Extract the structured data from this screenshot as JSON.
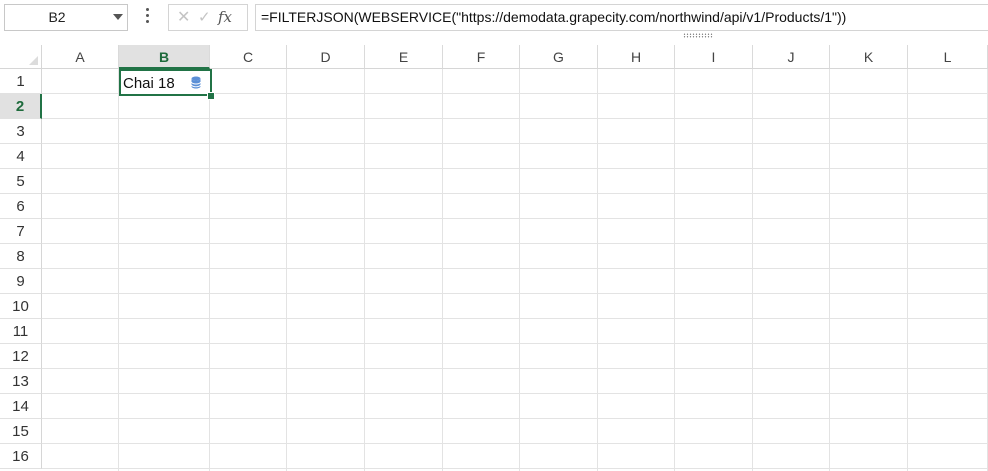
{
  "formula_bar": {
    "name_box": "B2",
    "cancel_icon": "close-icon",
    "enter_icon": "check-icon",
    "fx_label": "fx",
    "formula": "=FILTERJSON(WEBSERVICE(\"https://demodata.grapecity.com/northwind/api/v1/Products/1\"))"
  },
  "columns": [
    "A",
    "B",
    "C",
    "D",
    "E",
    "F",
    "G",
    "H",
    "I",
    "J",
    "K",
    "L"
  ],
  "rows": [
    "1",
    "2",
    "3",
    "4",
    "5",
    "6",
    "7",
    "8",
    "9",
    "10",
    "11",
    "12",
    "13",
    "14",
    "15",
    "16"
  ],
  "selection": {
    "cell": "B2",
    "column": "B",
    "row": "2"
  },
  "cells": {
    "B2": "Chai 18"
  },
  "colors": {
    "accent": "#217346",
    "header_selected_bg": "#e1e1e1",
    "gridline": "#e3e3e3",
    "datatype_icon": "#5b8fd6"
  }
}
